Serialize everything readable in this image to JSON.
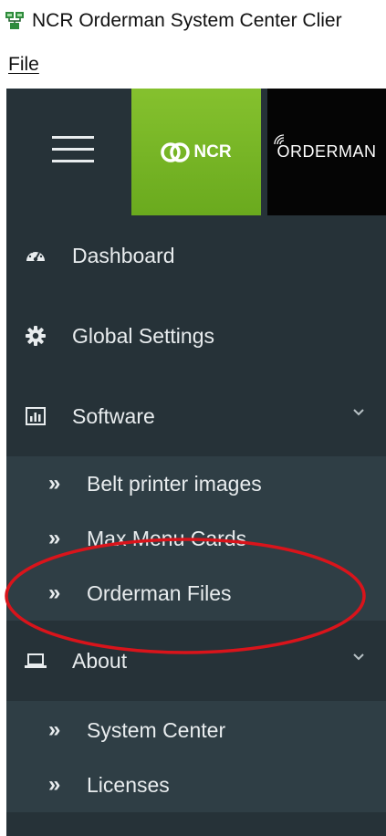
{
  "window": {
    "title": "NCR Orderman System Center Clier",
    "app_icon": "network-app-icon"
  },
  "menubar": {
    "items": [
      {
        "label": "File"
      }
    ]
  },
  "sidebar": {
    "header": {
      "menu_icon": "hamburger-icon",
      "ncr_logo_text": "NCR",
      "orderman_logo_text": "ORDERMAN",
      "ncr_tile_color": "#7ab928",
      "orderman_tile_color": "#050505"
    },
    "items": [
      {
        "label": "Dashboard",
        "icon": "dashboard-gauge-icon"
      },
      {
        "label": "Global Settings",
        "icon": "gear-icon"
      },
      {
        "label": "Software",
        "icon": "bar-chart-icon",
        "expanded": true,
        "children": [
          {
            "label": "Belt printer images"
          },
          {
            "label": "Max Menu Cards"
          },
          {
            "label": "Orderman Files"
          }
        ]
      },
      {
        "label": "About",
        "icon": "laptop-icon",
        "expanded": true,
        "children": [
          {
            "label": "System Center"
          },
          {
            "label": "Licenses"
          }
        ]
      }
    ],
    "submenu_arrow": "»",
    "colors": {
      "background": "#263238",
      "submenu_background": "#2f3e45",
      "text": "#e8ecee"
    }
  },
  "annotation": {
    "shape": "ellipse",
    "color": "#d9141b",
    "target": "Orderman Files"
  }
}
